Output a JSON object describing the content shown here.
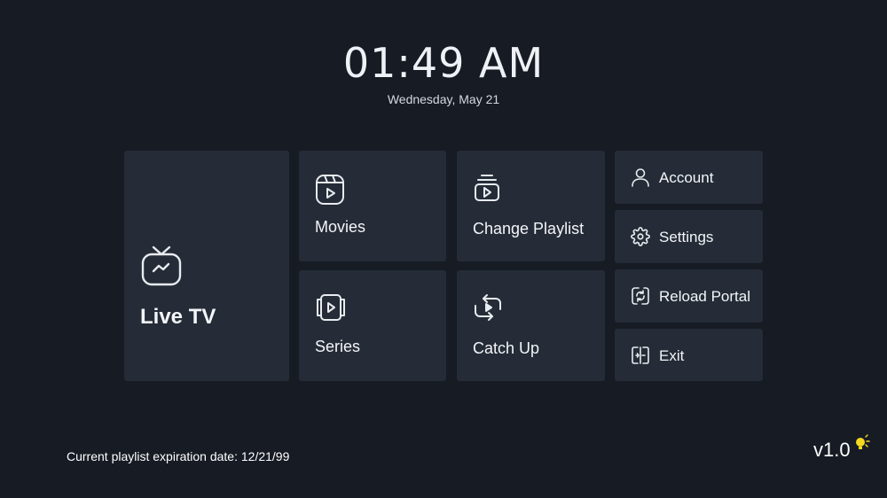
{
  "clock": {
    "time": "01:49 AM",
    "date": "Wednesday, May 21"
  },
  "menu": {
    "live_tv": "Live TV",
    "movies": "Movies",
    "series": "Series",
    "change_playlist": "Change Playlist",
    "catch_up": "Catch Up",
    "account": "Account",
    "settings": "Settings",
    "reload_portal": "Reload Portal",
    "exit": "Exit"
  },
  "footer": {
    "expiration": "Current playlist expiration date: 12/21/99",
    "version": "v1.0"
  },
  "colors": {
    "background": "#161b24",
    "tile": "#252c37",
    "accent_bulb": "#f5d820"
  },
  "icons": {
    "live_tv": "tv-icon",
    "movies": "film-play-icon",
    "series": "series-play-icon",
    "change_playlist": "playlist-icon",
    "catch_up": "catch-up-icon",
    "account": "user-icon",
    "settings": "gear-icon",
    "reload_portal": "reload-icon",
    "exit": "exit-icon",
    "version": "lightbulb-icon"
  }
}
